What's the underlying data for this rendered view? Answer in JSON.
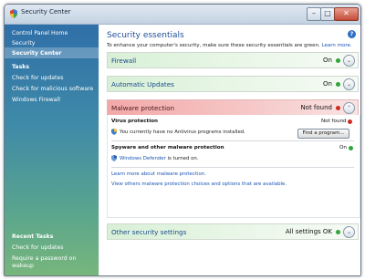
{
  "window": {
    "title": "Security Center",
    "minimize_glyph": "–",
    "maximize_glyph": "□",
    "close_glyph": "✕"
  },
  "sidebar": {
    "nav": [
      {
        "label": "Control Panel Home"
      },
      {
        "label": "Security"
      },
      {
        "label": "Security Center",
        "selected": true
      }
    ],
    "tasks_heading": "Tasks",
    "tasks": [
      {
        "label": "Check for updates"
      },
      {
        "label": "Check for malicious software"
      },
      {
        "label": "Windows Firewall"
      }
    ],
    "recent_heading": "Recent Tasks",
    "recent": [
      {
        "label": "Check for updates"
      },
      {
        "label": "Require a password on wakeup"
      }
    ]
  },
  "main": {
    "help_glyph": "?",
    "title": "Security essentials",
    "intro": "To enhance your computer's security, make sure these security essentials are green.",
    "intro_link": "Learn more.",
    "sections": {
      "firewall": {
        "label": "Firewall",
        "status": "On",
        "status_color": "#2fa53a"
      },
      "updates": {
        "label": "Automatic Updates",
        "status": "On",
        "status_color": "#2fa53a"
      },
      "malware": {
        "label": "Malware protection",
        "status": "Not found",
        "status_color": "#d02b22",
        "expanded": true
      },
      "other": {
        "label": "Other security settings",
        "status": "All settings OK",
        "status_color": "#2fa53a"
      }
    },
    "malware_detail": {
      "virus_title": "Virus protection",
      "virus_status": "Not found",
      "virus_text": "You currently have no Antivirus programs installed.",
      "find_button": "Find a program...",
      "spyware_title": "Spyware and other malware protection",
      "spyware_status": "On",
      "defender_link": "Windows Defender",
      "defender_text": "is turned on.",
      "learn_link": "Learn more about malware protection.",
      "view_link": "View others malware protection choices and options that are available."
    },
    "chevron_glyph": "⌄",
    "chevron_up_glyph": "⌃"
  }
}
